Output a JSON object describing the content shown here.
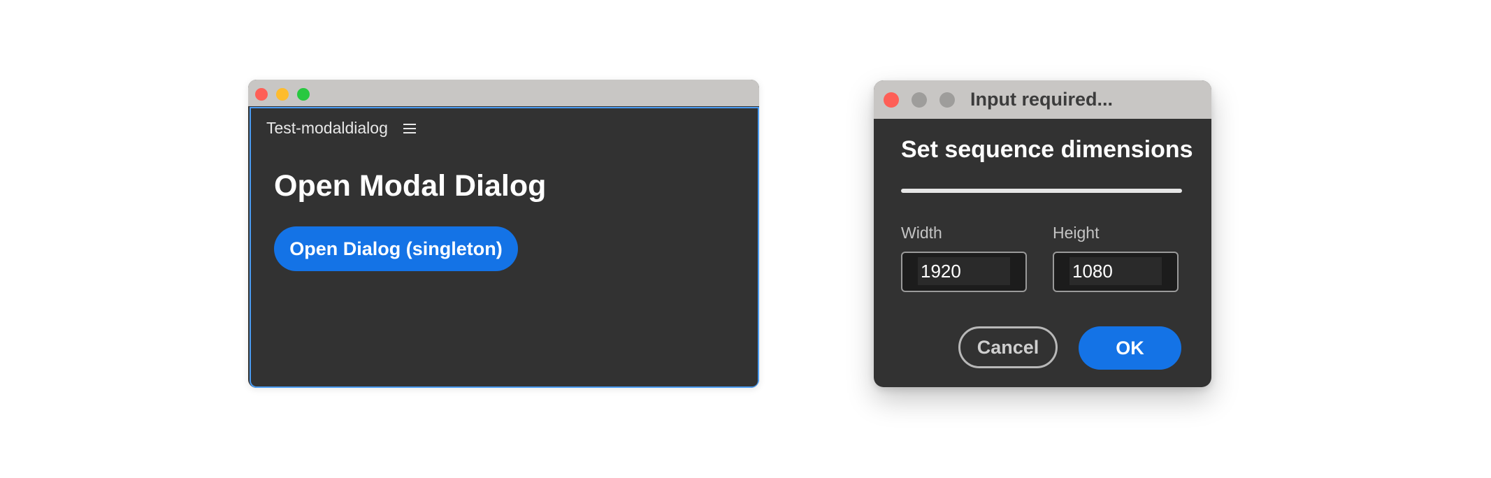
{
  "colors": {
    "accent": "#1473e6",
    "panel_bg": "#323232",
    "titlebar_bg": "#c8c6c4",
    "focus_border": "#4b9cf2",
    "traffic_red": "#fe5f57",
    "traffic_yellow": "#febc2e",
    "traffic_green": "#28c840",
    "traffic_inactive": "#9e9d9b"
  },
  "panel": {
    "tab_label": "Test-modaldialog",
    "menu_icon": "hamburger-menu-icon",
    "heading": "Open Modal Dialog",
    "open_button_label": "Open Dialog (singleton)"
  },
  "dialog": {
    "title": "Input required...",
    "heading": "Set sequence dimensions",
    "width_label": "Width",
    "width_value": "1920",
    "height_label": "Height",
    "height_value": "1080",
    "cancel_label": "Cancel",
    "ok_label": "OK"
  }
}
